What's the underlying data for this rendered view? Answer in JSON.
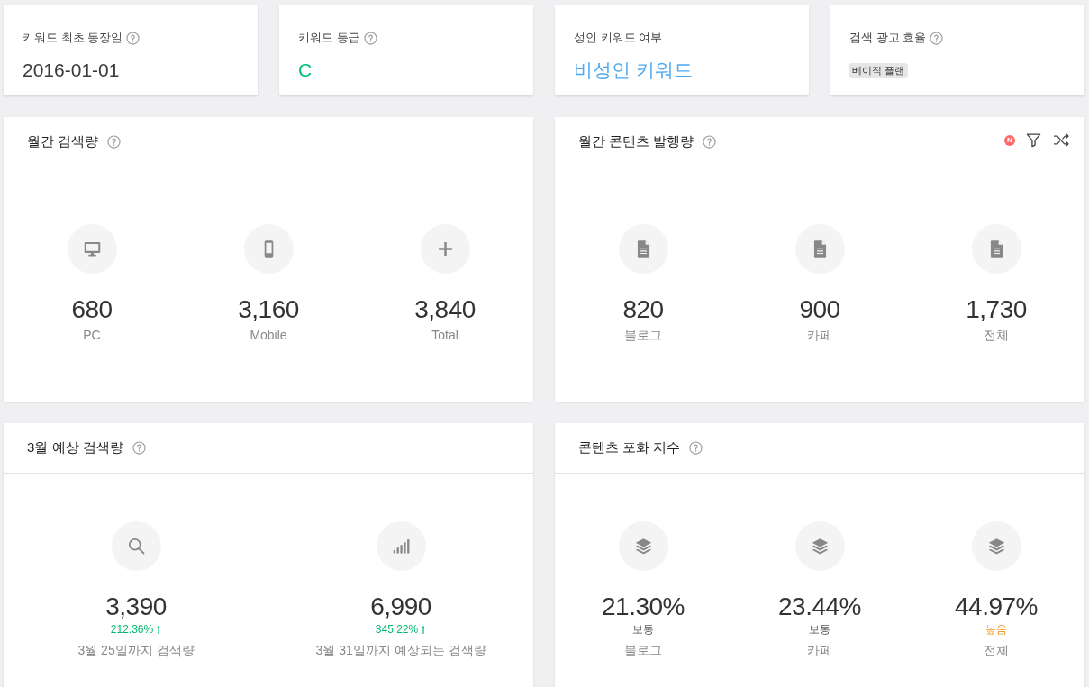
{
  "summary_cards": [
    {
      "label": "키워드 최초 등장일",
      "help": true,
      "kind": "date",
      "value": "2016-01-01"
    },
    {
      "label": "키워드 등급",
      "help": true,
      "kind": "grade",
      "value": "C"
    },
    {
      "label": "성인 키워드 여부",
      "help": false,
      "kind": "status",
      "value": "비성인 키워드"
    },
    {
      "label": "검색 광고 효율",
      "help": true,
      "kind": "tag",
      "value": "베이직 플랜"
    }
  ],
  "panels": [
    {
      "title": "월간 검색량",
      "help": true,
      "stats": [
        {
          "kind": "desktop",
          "value": "680",
          "label": "PC"
        },
        {
          "kind": "mobile",
          "value": "3,160",
          "label": "Mobile"
        },
        {
          "kind": "total",
          "value": "3,840",
          "label": "Total"
        }
      ]
    },
    {
      "title": "월간 콘텐츠 발행량",
      "help": true,
      "tools": [
        {
          "kind": "filter",
          "badge": "N"
        },
        {
          "kind": "shuffle"
        }
      ],
      "stats": [
        {
          "kind": "document",
          "value": "820",
          "label": "블로그"
        },
        {
          "kind": "document",
          "value": "900",
          "label": "카페"
        },
        {
          "kind": "document",
          "value": "1,730",
          "label": "전체"
        }
      ]
    },
    {
      "title": "3월 예상 검색량",
      "help": true,
      "stats": [
        {
          "kind": "search",
          "value": "3,390",
          "change": {
            "text": "212.36%",
            "rising": true
          },
          "label": "3월 25일까지 검색량"
        },
        {
          "kind": "trend",
          "value": "6,990",
          "change": {
            "text": "345.22%",
            "rising": true
          },
          "label": "3월 31일까지 예상되는 검색량"
        }
      ]
    },
    {
      "title": "콘텐츠 포화 지수",
      "help": true,
      "stats": [
        {
          "kind": "layers",
          "value": "21.30%",
          "rating": {
            "text": "보통",
            "high": false
          },
          "label": "블로그"
        },
        {
          "kind": "layers",
          "value": "23.44%",
          "rating": {
            "text": "보통",
            "high": false
          },
          "label": "카페"
        },
        {
          "kind": "layers",
          "value": "44.97%",
          "rating": {
            "text": "높음",
            "high": true
          },
          "label": "전체"
        }
      ]
    }
  ]
}
